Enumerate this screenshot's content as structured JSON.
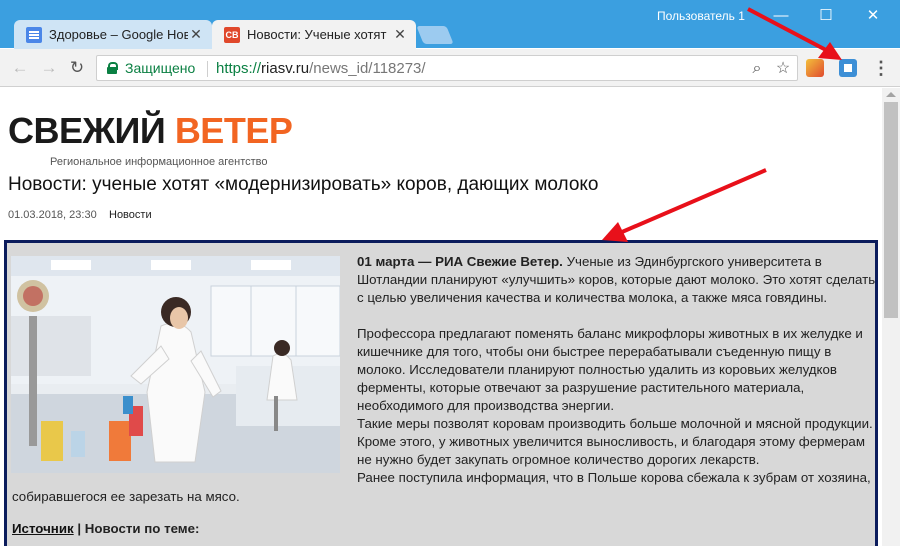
{
  "browser": {
    "tabs": [
      {
        "title": "Здоровье – Google Нов",
        "favicon": "google-news-icon"
      },
      {
        "title": "Новости: Ученые хотят",
        "favicon": "CB",
        "active": true
      }
    ],
    "profile_label": "Пользователь 1",
    "secure_label": "Защищено",
    "url": {
      "scheme": "https://",
      "host": "riasv.ru",
      "path": "/news_id/118273/"
    },
    "icons": {
      "back": "back-arrow-icon",
      "forward": "forward-arrow-icon",
      "reload": "reload-icon",
      "zoom": "zoom-icon",
      "bookmark": "star-icon",
      "menu": "menu-dots-icon"
    }
  },
  "site": {
    "logo_word1": "СВЕЖИЙ",
    "logo_word2": "ВЕТЕР",
    "tagline": "Региональное информационное агентство"
  },
  "article": {
    "headline": "Новости: ученые хотят «модернизировать» коров, дающих молоко",
    "date": "01.03.2018, 23:30",
    "category": "Новости",
    "lead_bold": "01 марта — РИА Свежие Ветер.",
    "lead_text": " Ученые из Эдинбургского университета в Шотландии планируют «улучшить» коров, которые дают молоко. Это хотят сделать с целью увеличения качества и количества молока, а также мяса говядины.",
    "p2": "Професcора предлагают поменять баланс микрофлоры животных в их желудке и кишечнике для того, чтобы они быстрее перерабатывали съеденную пищу в молоко. Исследователи планируют полностью удалить из коровьих желудков ферменты, которые отвечают за разрушение растительного материала, необходимого для производства энергии.",
    "p3": "Такие меры позволят коровам производить больше молочной и мясной продукции. Кроме этого, у животных увеличится выносливость, и благодаря этому фермерам не нужно будет закупать огромное количество дорогих лекарств.",
    "p4": "Ранее поступила информация, что в Польше корова сбежала к зубрам от хозяина,",
    "p4_wrap": "собиравшегося ее зарезать на мясо.",
    "source_label": "Источник",
    "related_label": " | Новости по теме:"
  },
  "colors": {
    "accent": "#f26522",
    "frame": "#0b1c5c",
    "secure": "#0b8043",
    "article_bg": "#d8d8d8",
    "annotation": "#e8101a"
  }
}
